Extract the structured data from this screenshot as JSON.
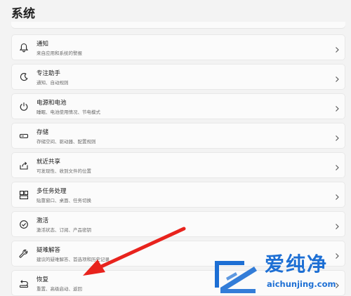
{
  "page": {
    "title": "系统"
  },
  "items": [
    {
      "id": "notifications",
      "icon": "bell-icon",
      "title": "通知",
      "subtitle": "来自应用和系统的警报"
    },
    {
      "id": "focus",
      "icon": "moon-icon",
      "title": "专注助手",
      "subtitle": "通知、自动规则"
    },
    {
      "id": "power",
      "icon": "power-icon",
      "title": "电源和电池",
      "subtitle": "睡眠、电池使用情况、节电模式"
    },
    {
      "id": "storage",
      "icon": "storage-drive-icon",
      "title": "存储",
      "subtitle": "存储空间、驱动器、配置规则"
    },
    {
      "id": "nearby-sharing",
      "icon": "share-icon",
      "title": "就近共享",
      "subtitle": "可发现性、收到文件的位置"
    },
    {
      "id": "multitasking",
      "icon": "multitask-windows-icon",
      "title": "多任务处理",
      "subtitle": "贴靠窗口、桌面、任务切换"
    },
    {
      "id": "activation",
      "icon": "check-circle-icon",
      "title": "激活",
      "subtitle": "激活状态、订阅、产品密钥"
    },
    {
      "id": "troubleshoot",
      "icon": "wrench-icon",
      "title": "疑难解答",
      "subtitle": "建议的疑难解答、首选项和历史记录"
    },
    {
      "id": "recovery",
      "icon": "recovery-icon",
      "title": "恢复",
      "subtitle": "重置、高级启动、返回"
    }
  ],
  "annotation": {
    "color": "#e8231d"
  },
  "watermark": {
    "title": "爱纯净",
    "url": "aichunjing.com",
    "color": "#1d6fd4"
  }
}
